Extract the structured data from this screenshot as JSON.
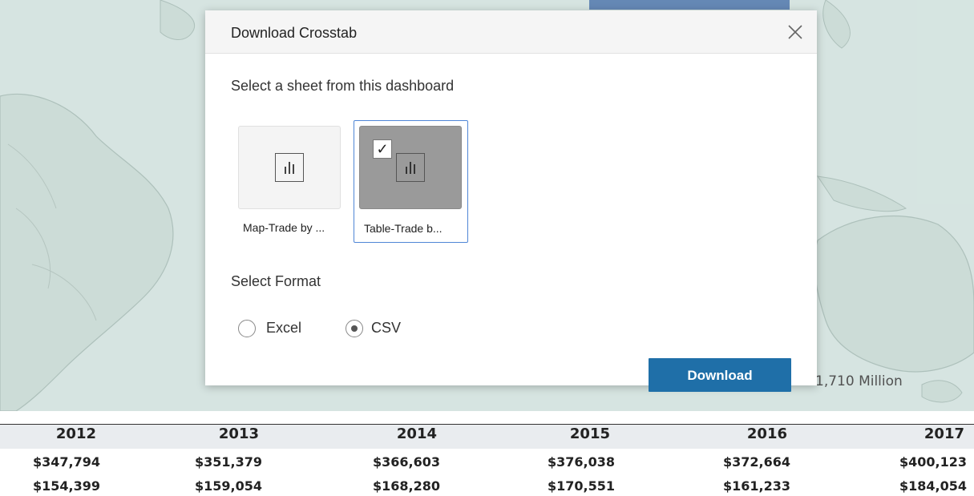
{
  "dialog": {
    "title": "Download Crosstab",
    "close_icon": "close-icon",
    "sheet_prompt": "Select a sheet from this dashboard",
    "sheets": [
      {
        "label": "Map-Trade by ...",
        "icon": "bar-chart-icon",
        "selected": false
      },
      {
        "label": "Table-Trade b...",
        "icon": "bar-chart-icon",
        "selected": true
      }
    ],
    "format_prompt": "Select Format",
    "formats": [
      {
        "label": "Excel",
        "selected": false
      },
      {
        "label": "CSV",
        "selected": true
      }
    ],
    "download_label": "Download",
    "colors": {
      "download_button": "#1f6fa8",
      "selected_border": "#4f86d6"
    }
  },
  "map": {
    "value_text": "1,710 Million"
  },
  "table": {
    "years": [
      "2012",
      "2013",
      "2014",
      "2015",
      "2016",
      "2017"
    ],
    "row1": [
      "$347,794",
      "$351,379",
      "$366,603",
      "$376,038",
      "$372,664",
      "$400,123"
    ],
    "row2": [
      "$154,399",
      "$159,054",
      "$168,280",
      "$170,551",
      "$161,233",
      "$184,054"
    ]
  }
}
